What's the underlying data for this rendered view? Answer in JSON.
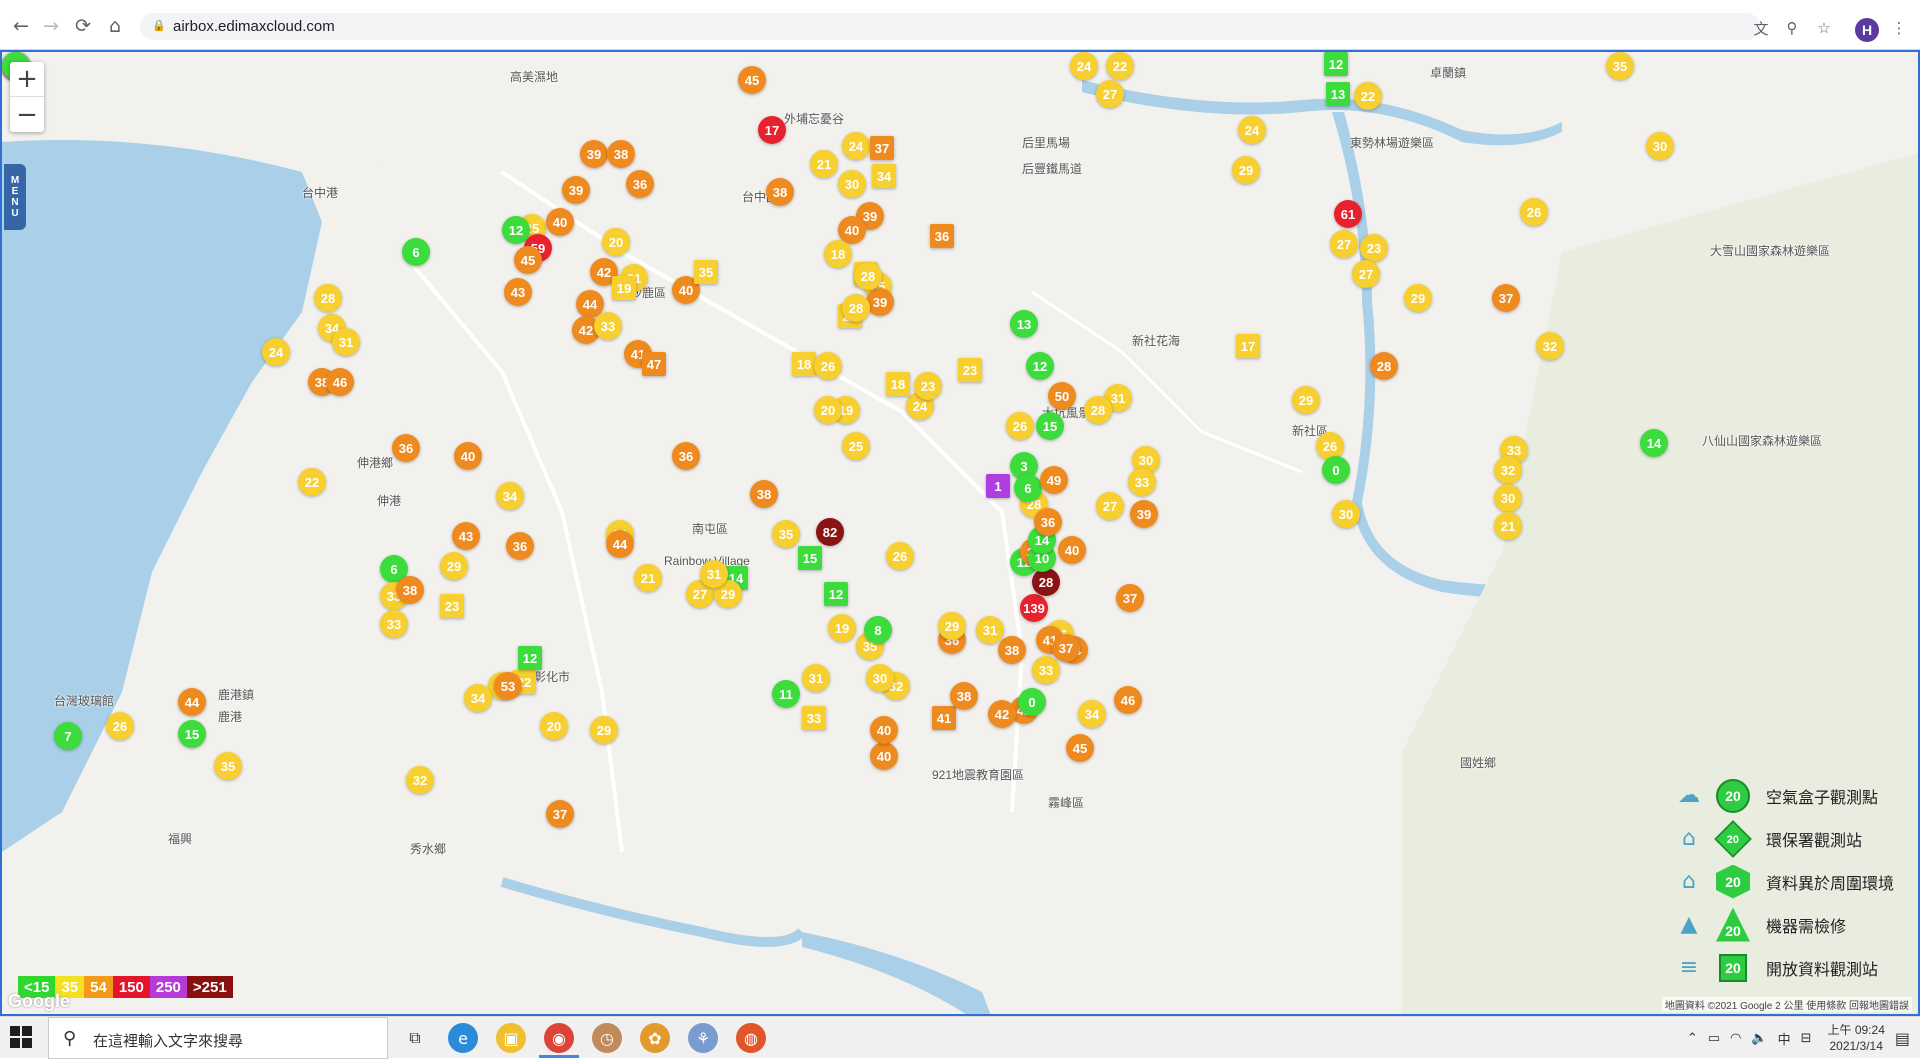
{
  "browser": {
    "url": "airbox.edimaxcloud.com",
    "profile_initial": "H",
    "back_icon": "back-arrow-icon",
    "forward_icon": "forward-arrow-icon",
    "reload_icon": "reload-icon",
    "home_icon": "home-icon"
  },
  "map": {
    "zoom_in_label": "+",
    "zoom_out_label": "−",
    "menu_label": "MENU",
    "places": [
      {
        "name": "卓蘭鎮"
      },
      {
        "name": "東勢林場遊樂區"
      },
      {
        "name": "大雪山國家森林遊樂區"
      },
      {
        "name": "后里馬場"
      },
      {
        "name": "后豐鐵馬道"
      },
      {
        "name": "新社花海"
      },
      {
        "name": "新社區"
      },
      {
        "name": "大坑風景區"
      },
      {
        "name": "八仙山國家森林遊樂區"
      },
      {
        "name": "沙鹿區"
      },
      {
        "name": "伸港鄉"
      },
      {
        "name": "伸港"
      },
      {
        "name": "南屯區"
      },
      {
        "name": "Rainbow Village"
      },
      {
        "name": "彰化市"
      },
      {
        "name": "鹿港鎮"
      },
      {
        "name": "鹿港"
      },
      {
        "name": "台灣玻璃館"
      },
      {
        "name": "秀水鄉"
      },
      {
        "name": "福興"
      },
      {
        "name": "921地震教育園區"
      },
      {
        "name": "霧峰區"
      },
      {
        "name": "國姓鄉"
      },
      {
        "name": "外埔忘憂谷"
      },
      {
        "name": "台中國際"
      },
      {
        "name": "高美濕地"
      },
      {
        "name": "台中港"
      }
    ],
    "markers": [
      {
        "v": "12",
        "c": "green"
      },
      {
        "v": "13",
        "c": "green"
      },
      {
        "v": "22",
        "c": "yellow"
      },
      {
        "v": "35",
        "c": "yellow"
      },
      {
        "v": "24",
        "c": "yellow"
      },
      {
        "v": "22",
        "c": "yellow"
      },
      {
        "v": "27",
        "c": "yellow"
      },
      {
        "v": "30",
        "c": "yellow"
      },
      {
        "v": "24",
        "c": "yellow"
      },
      {
        "v": "29",
        "c": "yellow"
      },
      {
        "v": "26",
        "c": "yellow"
      },
      {
        "v": "61",
        "c": "red"
      },
      {
        "v": "27",
        "c": "yellow"
      },
      {
        "v": "23",
        "c": "yellow"
      },
      {
        "v": "27",
        "c": "yellow"
      },
      {
        "v": "29",
        "c": "yellow"
      },
      {
        "v": "37",
        "c": "orange"
      },
      {
        "v": "32",
        "c": "yellow"
      },
      {
        "v": "28",
        "c": "orange"
      },
      {
        "v": "17",
        "c": "yellow"
      },
      {
        "v": "29",
        "c": "yellow"
      },
      {
        "v": "26",
        "c": "yellow"
      },
      {
        "v": "0",
        "c": "green"
      },
      {
        "v": "30",
        "c": "yellow"
      },
      {
        "v": "33",
        "c": "yellow"
      },
      {
        "v": "32",
        "c": "yellow"
      },
      {
        "v": "30",
        "c": "yellow"
      },
      {
        "v": "21",
        "c": "yellow"
      },
      {
        "v": "14",
        "c": "green"
      },
      {
        "v": "31",
        "c": "yellow"
      },
      {
        "v": "30",
        "c": "yellow"
      },
      {
        "v": "33",
        "c": "yellow"
      },
      {
        "v": "39",
        "c": "orange"
      },
      {
        "v": "50",
        "c": "orange"
      },
      {
        "v": "12",
        "c": "green"
      },
      {
        "v": "27",
        "c": "yellow"
      },
      {
        "v": "37",
        "c": "orange"
      },
      {
        "v": "46",
        "c": "orange"
      },
      {
        "v": "45",
        "c": "orange"
      },
      {
        "v": "40",
        "c": "orange"
      },
      {
        "v": "32",
        "c": "yellow"
      },
      {
        "v": "38",
        "c": "orange"
      },
      {
        "v": "36",
        "c": "orange"
      },
      {
        "v": "42",
        "c": "orange"
      },
      {
        "v": "33",
        "c": "yellow"
      },
      {
        "v": "34",
        "c": "yellow"
      },
      {
        "v": "16",
        "c": "yellow"
      },
      {
        "v": "139",
        "c": "red"
      },
      {
        "v": "41",
        "c": "orange"
      },
      {
        "v": "44",
        "c": "orange"
      },
      {
        "v": "37",
        "c": "orange"
      },
      {
        "v": "0",
        "c": "green"
      },
      {
        "v": "42",
        "c": "orange"
      },
      {
        "v": "41",
        "c": "orange"
      },
      {
        "v": "38",
        "c": "orange"
      },
      {
        "v": "40",
        "c": "orange"
      },
      {
        "v": "30",
        "c": "yellow"
      },
      {
        "v": "35",
        "c": "yellow"
      },
      {
        "v": "11",
        "c": "green"
      },
      {
        "v": "33",
        "c": "yellow"
      },
      {
        "v": "31",
        "c": "yellow"
      },
      {
        "v": "19",
        "c": "yellow"
      },
      {
        "v": "12",
        "c": "green"
      },
      {
        "v": "15",
        "c": "green"
      },
      {
        "v": "82",
        "c": "dark"
      },
      {
        "v": "38",
        "c": "orange"
      },
      {
        "v": "35",
        "c": "yellow"
      },
      {
        "v": "32",
        "c": "yellow"
      },
      {
        "v": "21",
        "c": "yellow"
      },
      {
        "v": "27",
        "c": "yellow"
      },
      {
        "v": "14",
        "c": "green"
      },
      {
        "v": "29",
        "c": "yellow"
      },
      {
        "v": "31",
        "c": "yellow"
      },
      {
        "v": "6",
        "c": "green"
      },
      {
        "v": "33",
        "c": "yellow"
      },
      {
        "v": "25",
        "c": "yellow"
      },
      {
        "v": "36",
        "c": "orange"
      },
      {
        "v": "34",
        "c": "yellow"
      },
      {
        "v": "22",
        "c": "yellow"
      },
      {
        "v": "7",
        "c": "green"
      },
      {
        "v": "15",
        "c": "green"
      },
      {
        "v": "44",
        "c": "orange"
      },
      {
        "v": "35",
        "c": "yellow"
      },
      {
        "v": "26",
        "c": "yellow"
      },
      {
        "v": "53",
        "c": "orange"
      },
      {
        "v": "12",
        "c": "green"
      },
      {
        "v": "29",
        "c": "yellow"
      },
      {
        "v": "20",
        "c": "yellow"
      },
      {
        "v": "32",
        "c": "yellow"
      },
      {
        "v": "37",
        "c": "orange"
      },
      {
        "v": "29",
        "c": "yellow"
      },
      {
        "v": "23",
        "c": "yellow"
      },
      {
        "v": "33",
        "c": "yellow"
      },
      {
        "v": "38",
        "c": "orange"
      },
      {
        "v": "34",
        "c": "yellow"
      },
      {
        "v": "31",
        "c": "yellow"
      },
      {
        "v": "38",
        "c": "orange"
      },
      {
        "v": "46",
        "c": "orange"
      },
      {
        "v": "36",
        "c": "orange"
      },
      {
        "v": "40",
        "c": "orange"
      },
      {
        "v": "43",
        "c": "orange"
      },
      {
        "v": "28",
        "c": "yellow"
      },
      {
        "v": "6",
        "c": "green"
      },
      {
        "v": "24",
        "c": "yellow"
      },
      {
        "v": "22",
        "c": "yellow"
      },
      {
        "v": "34",
        "c": "yellow"
      },
      {
        "v": "25",
        "c": "yellow"
      },
      {
        "v": "12",
        "c": "green"
      },
      {
        "v": "59",
        "c": "red"
      },
      {
        "v": "45",
        "c": "orange"
      },
      {
        "v": "42",
        "c": "orange"
      },
      {
        "v": "43",
        "c": "orange"
      },
      {
        "v": "39",
        "c": "orange"
      },
      {
        "v": "38",
        "c": "orange"
      },
      {
        "v": "36",
        "c": "orange"
      },
      {
        "v": "39",
        "c": "orange"
      },
      {
        "v": "40",
        "c": "orange"
      },
      {
        "v": "20",
        "c": "yellow"
      },
      {
        "v": "44",
        "c": "orange"
      },
      {
        "v": "31",
        "c": "yellow"
      },
      {
        "v": "19",
        "c": "yellow"
      },
      {
        "v": "42",
        "c": "orange"
      },
      {
        "v": "33",
        "c": "yellow"
      },
      {
        "v": "41",
        "c": "orange"
      },
      {
        "v": "40",
        "c": "orange"
      },
      {
        "v": "45",
        "c": "orange"
      },
      {
        "v": "17",
        "c": "red"
      },
      {
        "v": "35",
        "c": "yellow"
      },
      {
        "v": "38",
        "c": "orange"
      },
      {
        "v": "39",
        "c": "orange"
      },
      {
        "v": "36",
        "c": "orange"
      },
      {
        "v": "47",
        "c": "orange"
      },
      {
        "v": "24",
        "c": "yellow"
      },
      {
        "v": "37",
        "c": "orange"
      },
      {
        "v": "34",
        "c": "yellow"
      },
      {
        "v": "36",
        "c": "orange"
      },
      {
        "v": "40",
        "c": "orange"
      },
      {
        "v": "18",
        "c": "yellow"
      },
      {
        "v": "35",
        "c": "yellow"
      },
      {
        "v": "39",
        "c": "orange"
      },
      {
        "v": "20",
        "c": "yellow"
      },
      {
        "v": "28",
        "c": "yellow"
      },
      {
        "v": "33",
        "c": "yellow"
      },
      {
        "v": "30",
        "c": "yellow"
      },
      {
        "v": "21",
        "c": "yellow"
      },
      {
        "v": "28",
        "c": "yellow"
      },
      {
        "v": "18",
        "c": "yellow"
      },
      {
        "v": "26",
        "c": "yellow"
      },
      {
        "v": "19",
        "c": "yellow"
      },
      {
        "v": "25",
        "c": "yellow"
      },
      {
        "v": "24",
        "c": "yellow"
      },
      {
        "v": "18",
        "c": "yellow"
      },
      {
        "v": "23",
        "c": "yellow"
      },
      {
        "v": "26",
        "c": "yellow"
      },
      {
        "v": "15",
        "c": "green"
      },
      {
        "v": "13",
        "c": "green"
      },
      {
        "v": "8",
        "c": "green"
      },
      {
        "v": "23",
        "c": "yellow"
      },
      {
        "v": "28",
        "c": "yellow"
      },
      {
        "v": "20",
        "c": "yellow"
      },
      {
        "v": "29",
        "c": "yellow"
      },
      {
        "v": "31",
        "c": "yellow"
      },
      {
        "v": "26",
        "c": "yellow"
      },
      {
        "v": "28",
        "c": "yellow"
      },
      {
        "v": "3",
        "c": "green"
      },
      {
        "v": "1",
        "c": "purple"
      },
      {
        "v": "12",
        "c": "green"
      },
      {
        "v": "28",
        "c": "dark"
      },
      {
        "v": "40",
        "c": "orange"
      },
      {
        "v": "39",
        "c": "orange"
      },
      {
        "v": "10",
        "c": "green"
      },
      {
        "v": "14",
        "c": "green"
      },
      {
        "v": "6",
        "c": "green"
      },
      {
        "v": "49",
        "c": "orange"
      },
      {
        "v": "36",
        "c": "orange"
      },
      {
        "v": "44",
        "c": "orange"
      },
      {
        "v": "29",
        "c": "yellow"
      },
      {
        "v": "13",
        "c": "green"
      },
      {
        "v": "17",
        "c": "yellow"
      },
      {
        "v": "9",
        "c": "green"
      }
    ],
    "color_legend": [
      {
        "label": "<15",
        "color": "#2fd82f"
      },
      {
        "label": "35",
        "color": "#f5e020"
      },
      {
        "label": "54",
        "color": "#f29b1b"
      },
      {
        "label": "150",
        "color": "#e4142b"
      },
      {
        "label": "250",
        "color": "#b53ad8"
      },
      {
        "label": ">251",
        "color": "#8a1010"
      }
    ],
    "legend": [
      {
        "label": "空氣盒子觀測點",
        "badge": "20",
        "icon": "airbox-icon",
        "shape": "circle"
      },
      {
        "label": "環保署觀測站",
        "badge": "20",
        "icon": "government-building-icon",
        "shape": "diamond"
      },
      {
        "label": "資料異於周圍環境",
        "badge": "20",
        "icon": "house-icon",
        "shape": "hex"
      },
      {
        "label": "機器需檢修",
        "badge": "20",
        "icon": "tower-icon",
        "shape": "tri"
      },
      {
        "label": "開放資料觀測站",
        "badge": "20",
        "icon": "database-icon",
        "shape": "sq"
      }
    ],
    "footer": "地圖資料 ©2021 Google   2 公里        使用條款   回報地圖錯誤",
    "google_logo": "Google"
  },
  "taskbar": {
    "search_placeholder": "在這裡輸入文字來搜尋",
    "time": "上午 09:24",
    "date": "2021/3/14",
    "ime": "中",
    "apps": [
      "task-view-icon",
      "edge-icon",
      "file-explorer-icon",
      "chrome-icon",
      "app-icon-1",
      "app-icon-2",
      "app-icon-3",
      "app-icon-4"
    ]
  }
}
